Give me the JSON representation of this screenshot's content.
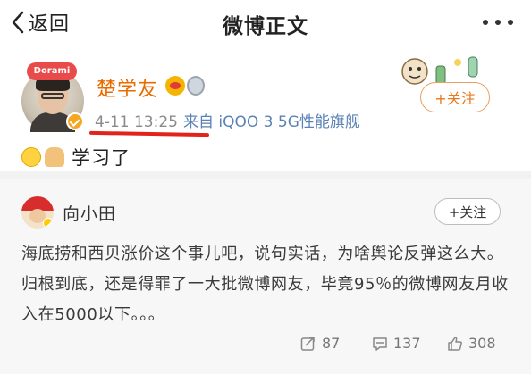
{
  "nav": {
    "back_label": "返回",
    "title": "微博正文"
  },
  "post": {
    "author_name": "楚学友",
    "time": "4-11 13:25",
    "source": "来自 iQOO 3 5G性能旗舰",
    "body": "学习了",
    "follow_label": "+关注",
    "avatar_deco_text": "Dorami"
  },
  "repost": {
    "author_name": "向小田",
    "follow_label": "+关注",
    "text": "海底捞和西贝涨价这个事儿吧，说句实话，为啥舆论反弹这么大。归根到底，还是得罪了一大批微博网友，毕竟95％的微博网友月收入在5000以下。。。",
    "repost_count": "87",
    "comment_count": "137",
    "like_count": "308"
  },
  "colors": {
    "accent_orange": "#e8781c",
    "underline_red": "#e2231a",
    "source_blue": "#5a82b5"
  }
}
